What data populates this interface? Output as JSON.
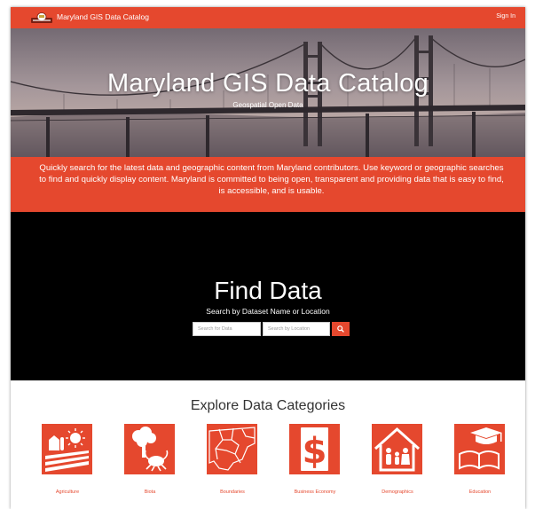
{
  "nav": {
    "logo_icon": "maryland-state-seal-logo",
    "title": "Maryland GIS Data Catalog",
    "signin_label": "Sign In"
  },
  "hero": {
    "title": "Maryland GIS Data Catalog",
    "subtitle": "Geospatial Open Data",
    "background_icon": "bay-bridge-photo"
  },
  "description": "Quickly search for the latest data and geographic content from Maryland contributors. Use keyword or geographic searches to find and quickly display content. Maryland is committed to being open, transparent and providing data that is easy to find, is accessible, and is usable.",
  "find_data": {
    "title": "Find Data",
    "subtitle": "Search by Dataset Name or Location",
    "data_placeholder": "Search for Data",
    "location_placeholder": "Search by Location",
    "search_icon": "search-icon"
  },
  "categories": {
    "title": "Explore Data Categories",
    "items": [
      {
        "label": "Agriculture",
        "icon": "agriculture-icon"
      },
      {
        "label": "Biota",
        "icon": "biota-icon"
      },
      {
        "label": "Boundaries",
        "icon": "boundaries-icon"
      },
      {
        "label": "Business Economy",
        "icon": "business-economy-icon"
      },
      {
        "label": "Demographics",
        "icon": "demographics-icon"
      },
      {
        "label": "Education",
        "icon": "education-icon"
      }
    ]
  },
  "colors": {
    "accent": "#e5482e",
    "find_background": "#000000",
    "page_background": "#ffffff"
  }
}
